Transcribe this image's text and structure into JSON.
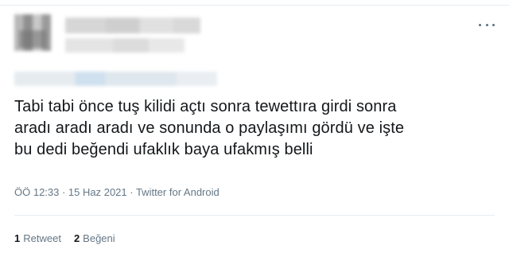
{
  "tweet": {
    "text_lines": [
      "Tabi tabi önce tuş kilidi açtı sonra tewettıra girdi sonra",
      "aradı aradı aradı ve sonunda o paylaşımı gördü ve işte",
      "bu dedi beğendi ufaklık baya ufakmış belli"
    ],
    "meta": "ÖÖ 12:33 · 15 Haz 2021 · Twitter for Android",
    "stats": {
      "retweet_count": "1",
      "retweet_label": "Retweet",
      "like_count": "2",
      "like_label": "Beğeni"
    }
  }
}
